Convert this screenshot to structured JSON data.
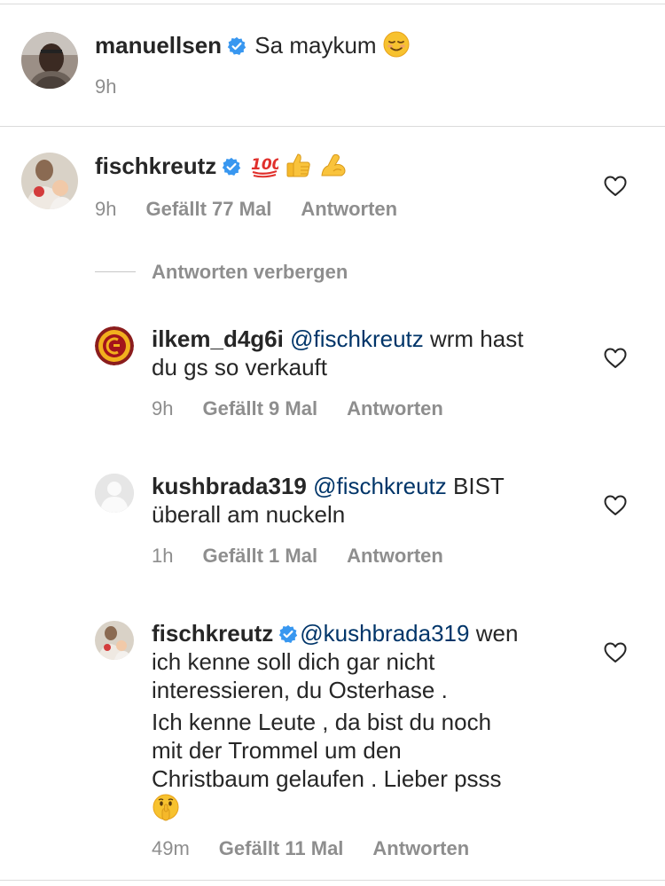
{
  "comments": [
    {
      "username": "manuellsen",
      "verified": true,
      "text": "Sa maykum",
      "emojis": [
        "relieved-smile-emoji"
      ],
      "time": "9h"
    },
    {
      "username": "fischkreutz",
      "verified": true,
      "text": "",
      "emojis": [
        "hundred-points-emoji",
        "thumbs-up-emoji",
        "flexed-biceps-emoji"
      ],
      "time": "9h",
      "likes": "Gefällt 77 Mal",
      "reply_label": "Antworten",
      "hide_replies_label": "Antworten verbergen",
      "replies": [
        {
          "username": "ilkem_d4g6i",
          "mention": "@fischkreutz",
          "text_line1": "wrm hast",
          "text_line2": "du gs so verkauft",
          "time": "9h",
          "likes": "Gefällt 9 Mal",
          "reply_label": "Antworten"
        },
        {
          "username": "kushbrada319",
          "mention": "@fischkreutz",
          "text_line1": "BIST",
          "text_line2": "überall am nuckeln",
          "time": "1h",
          "likes": "Gefällt 1 Mal",
          "reply_label": "Antworten"
        },
        {
          "username": "fischkreutz",
          "verified": true,
          "mention": "@kushbrada319",
          "text_line1": "wen",
          "text_line2": "ich kenne soll dich gar nicht",
          "text_line3": "interessieren, du Osterhase .",
          "text_line4": "Ich kenne Leute , da bist du noch",
          "text_line5": "mit der Trommel um den",
          "text_line6": "Christbaum gelaufen . Lieber psss",
          "emojis": [
            "shushing-face-emoji"
          ],
          "time": "49m",
          "likes": "Gefällt 11 Mal",
          "reply_label": "Antworten"
        }
      ]
    }
  ],
  "colors": {
    "text": "#262626",
    "meta": "#8e8e8e",
    "mention": "#003569",
    "verified": "#3897f0",
    "divider": "#dbdbdb"
  }
}
